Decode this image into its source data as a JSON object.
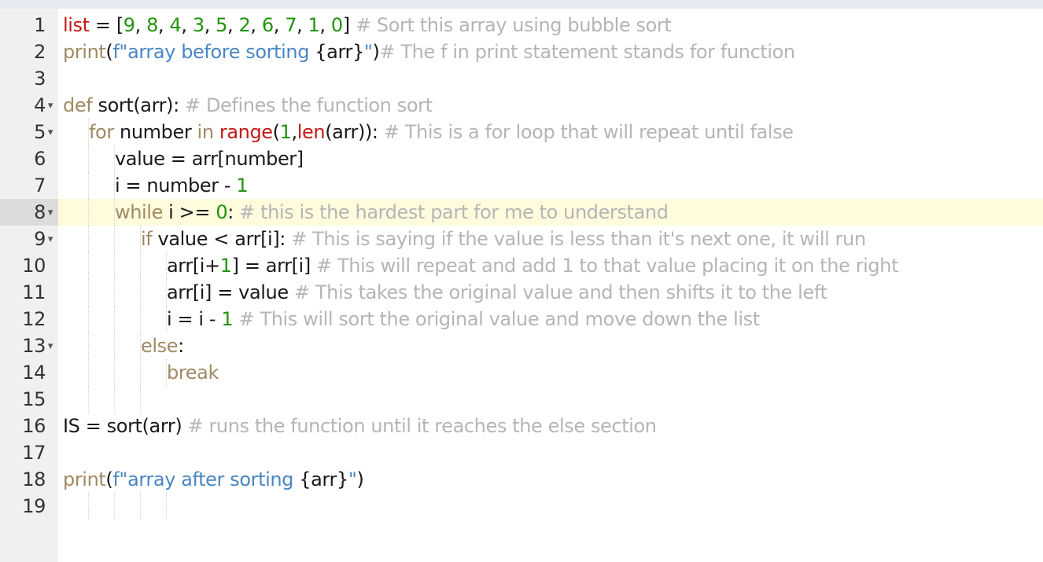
{
  "editor": {
    "active_line": 8,
    "fold_icon": "fold-caret-icon",
    "colors": {
      "keyword": "#a08a63",
      "variable": "#c41a16",
      "number": "#22930d",
      "string": "#4a86c5",
      "comment": "#b5b5b5",
      "active_line": "#fffbdd"
    },
    "lines": [
      {
        "n": "1",
        "fold": "",
        "indent": 0,
        "tokens": [
          {
            "t": "list",
            "c": "var"
          },
          {
            "t": " = [",
            "c": ""
          },
          {
            "t": "9",
            "c": "num"
          },
          {
            "t": ", ",
            "c": ""
          },
          {
            "t": "8",
            "c": "num"
          },
          {
            "t": ", ",
            "c": ""
          },
          {
            "t": "4",
            "c": "num"
          },
          {
            "t": ", ",
            "c": ""
          },
          {
            "t": "3",
            "c": "num"
          },
          {
            "t": ", ",
            "c": ""
          },
          {
            "t": "5",
            "c": "num"
          },
          {
            "t": ", ",
            "c": ""
          },
          {
            "t": "2",
            "c": "num"
          },
          {
            "t": ", ",
            "c": ""
          },
          {
            "t": "6",
            "c": "num"
          },
          {
            "t": ", ",
            "c": ""
          },
          {
            "t": "7",
            "c": "num"
          },
          {
            "t": ", ",
            "c": ""
          },
          {
            "t": "1",
            "c": "num"
          },
          {
            "t": ", ",
            "c": ""
          },
          {
            "t": "0",
            "c": "num"
          },
          {
            "t": "] ",
            "c": ""
          },
          {
            "t": "# Sort this array using bubble sort",
            "c": "cm"
          }
        ]
      },
      {
        "n": "2",
        "fold": "",
        "indent": 0,
        "tokens": [
          {
            "t": "print",
            "c": "kw"
          },
          {
            "t": "(",
            "c": ""
          },
          {
            "t": "f\"array before sorting ",
            "c": "str"
          },
          {
            "t": "{arr}",
            "c": ""
          },
          {
            "t": "\"",
            "c": "str"
          },
          {
            "t": ")",
            "c": ""
          },
          {
            "t": "# The f in print statement stands for function",
            "c": "cm"
          }
        ]
      },
      {
        "n": "3",
        "fold": "",
        "indent": 0,
        "tokens": []
      },
      {
        "n": "4",
        "fold": "▾",
        "indent": 0,
        "tokens": [
          {
            "t": "def",
            "c": "kw"
          },
          {
            "t": " sort(arr): ",
            "c": ""
          },
          {
            "t": "# Defines the function sort",
            "c": "cm"
          }
        ]
      },
      {
        "n": "5",
        "fold": "▾",
        "indent": 1,
        "tokens": [
          {
            "t": "for",
            "c": "kw"
          },
          {
            "t": " number ",
            "c": ""
          },
          {
            "t": "in",
            "c": "kw"
          },
          {
            "t": " ",
            "c": ""
          },
          {
            "t": "range",
            "c": "var"
          },
          {
            "t": "(",
            "c": ""
          },
          {
            "t": "1",
            "c": "num"
          },
          {
            "t": ",",
            "c": ""
          },
          {
            "t": "len",
            "c": "var"
          },
          {
            "t": "(arr)): ",
            "c": ""
          },
          {
            "t": "# This is a for loop that will repeat until false",
            "c": "cm"
          }
        ]
      },
      {
        "n": "6",
        "fold": "",
        "indent": 2,
        "tokens": [
          {
            "t": "value = arr[number]",
            "c": ""
          }
        ]
      },
      {
        "n": "7",
        "fold": "",
        "indent": 2,
        "tokens": [
          {
            "t": "i = number - ",
            "c": ""
          },
          {
            "t": "1",
            "c": "num"
          }
        ]
      },
      {
        "n": "8",
        "fold": "▾",
        "indent": 2,
        "tokens": [
          {
            "t": "while",
            "c": "kw"
          },
          {
            "t": " i >= ",
            "c": ""
          },
          {
            "t": "0",
            "c": "num"
          },
          {
            "t": ": ",
            "c": ""
          },
          {
            "t": "# this is the hardest part for me to understand",
            "c": "cm"
          }
        ]
      },
      {
        "n": "9",
        "fold": "▾",
        "indent": 3,
        "tokens": [
          {
            "t": "if",
            "c": "kw"
          },
          {
            "t": " value < arr[i]: ",
            "c": ""
          },
          {
            "t": "# This is saying if the value is less than it's next one, it will run",
            "c": "cm"
          }
        ]
      },
      {
        "n": "10",
        "fold": "",
        "indent": 4,
        "tokens": [
          {
            "t": "arr[i+",
            "c": ""
          },
          {
            "t": "1",
            "c": "num"
          },
          {
            "t": "] = arr[i] ",
            "c": ""
          },
          {
            "t": "# This will repeat and add 1 to that value placing it on the right",
            "c": "cm"
          }
        ]
      },
      {
        "n": "11",
        "fold": "",
        "indent": 4,
        "tokens": [
          {
            "t": "arr[i] = value ",
            "c": ""
          },
          {
            "t": "# This takes the original value and then shifts it to the left",
            "c": "cm"
          }
        ]
      },
      {
        "n": "12",
        "fold": "",
        "indent": 4,
        "tokens": [
          {
            "t": "i = i - ",
            "c": ""
          },
          {
            "t": "1",
            "c": "num"
          },
          {
            "t": " ",
            "c": ""
          },
          {
            "t": "# This will sort the original value and move down the list",
            "c": "cm"
          }
        ]
      },
      {
        "n": "13",
        "fold": "▾",
        "indent": 3,
        "tokens": [
          {
            "t": "else",
            "c": "kw"
          },
          {
            "t": ":",
            "c": ""
          }
        ]
      },
      {
        "n": "14",
        "fold": "",
        "indent": 4,
        "tokens": [
          {
            "t": "break",
            "c": "kw"
          }
        ]
      },
      {
        "n": "15",
        "fold": "",
        "indent": 0,
        "guides": 3,
        "tokens": []
      },
      {
        "n": "16",
        "fold": "",
        "indent": 0,
        "tokens": [
          {
            "t": "IS = sort(arr) ",
            "c": ""
          },
          {
            "t": "# runs the function until it reaches the else section",
            "c": "cm"
          }
        ]
      },
      {
        "n": "17",
        "fold": "",
        "indent": 0,
        "tokens": []
      },
      {
        "n": "18",
        "fold": "",
        "indent": 0,
        "tokens": [
          {
            "t": "print",
            "c": "kw"
          },
          {
            "t": "(",
            "c": ""
          },
          {
            "t": "f\"array after sorting ",
            "c": "str"
          },
          {
            "t": "{arr}",
            "c": ""
          },
          {
            "t": "\"",
            "c": "str"
          },
          {
            "t": ")",
            "c": ""
          }
        ]
      },
      {
        "n": "19",
        "fold": "",
        "indent": 0,
        "guides": 4,
        "tokens": []
      }
    ]
  }
}
